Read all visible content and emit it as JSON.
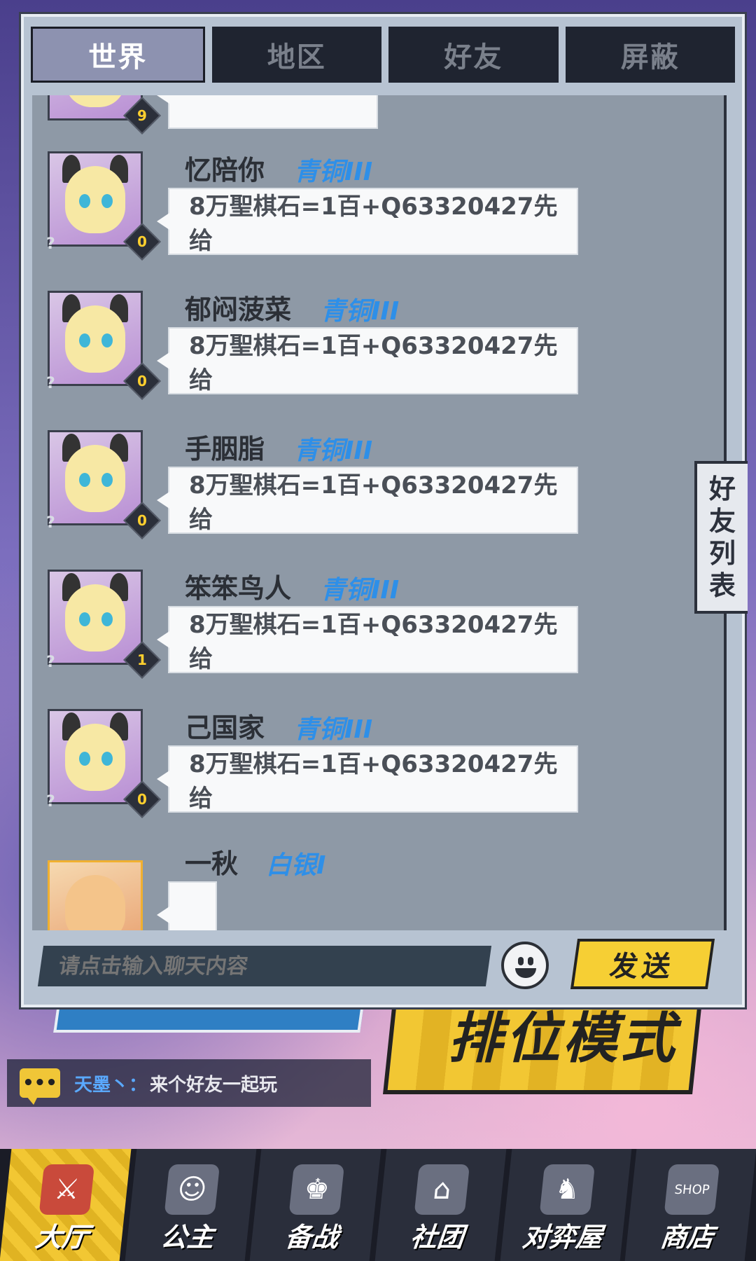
{
  "tabs": [
    "世界",
    "地区",
    "好友",
    "屏蔽"
  ],
  "partial_top": {
    "level": "9"
  },
  "messages": [
    {
      "name": "忆陪你",
      "rank": "青铜III",
      "text": "8万聖棋石=1百+Q63320427先给",
      "level": "0"
    },
    {
      "name": "郁闷菠菜",
      "rank": "青铜III",
      "text": "8万聖棋石=1百+Q63320427先给",
      "level": "0"
    },
    {
      "name": "手胭脂",
      "rank": "青铜III",
      "text": "8万聖棋石=1百+Q63320427先给",
      "level": "0"
    },
    {
      "name": "笨笨鸟人",
      "rank": "青铜III",
      "text": "8万聖棋石=1百+Q63320427先给",
      "level": "1"
    },
    {
      "name": "己国家",
      "rank": "青铜III",
      "text": "8万聖棋石=1百+Q63320427先给",
      "level": "0"
    }
  ],
  "last_message": {
    "name": "一秋",
    "rank": "白银I"
  },
  "side_tab": [
    "好",
    "友",
    "列",
    "表"
  ],
  "input": {
    "placeholder": "请点击输入聊天内容"
  },
  "send_label": "发送",
  "broadcast": {
    "name": "天墨丶：",
    "text": "来个好友一起玩"
  },
  "background_banner": "排位模式",
  "nav": [
    {
      "label": "大厅",
      "icon": "⚔"
    },
    {
      "label": "公主",
      "icon": "☺"
    },
    {
      "label": "备战",
      "icon": "♚"
    },
    {
      "label": "社团",
      "icon": "⌂"
    },
    {
      "label": "对弈屋",
      "icon": "♞"
    },
    {
      "label": "商店",
      "icon": "SHOP"
    }
  ]
}
